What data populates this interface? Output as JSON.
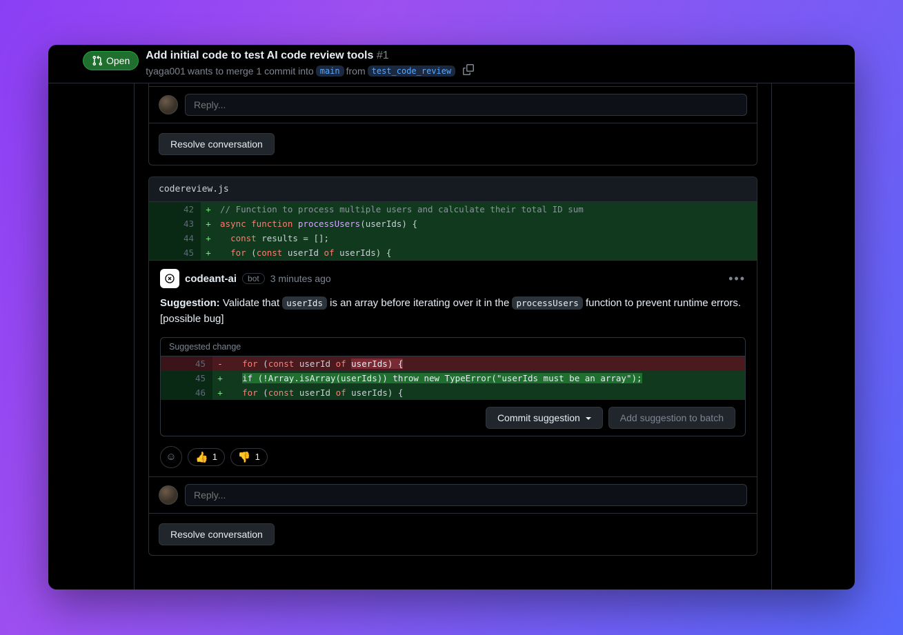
{
  "header": {
    "state": "Open",
    "title": "Add initial code to test AI code review tools",
    "number": "#1",
    "author": "tyaga001",
    "merge_text_1": " wants to merge 1 commit into ",
    "base_branch": "main",
    "merge_text_2": " from ",
    "head_branch": "test_code_review"
  },
  "panel1": {
    "reply_placeholder": "Reply...",
    "resolve_label": "Resolve conversation"
  },
  "code_panel": {
    "filename": "codereview.js",
    "lines": [
      {
        "n": "42",
        "m": "+",
        "code": "// Function to process multiple users and calculate their total ID sum",
        "cls": "comment"
      },
      {
        "n": "43",
        "m": "+",
        "code": [
          "async ",
          "function ",
          "processUsers",
          "(",
          "userIds",
          ") {"
        ]
      },
      {
        "n": "44",
        "m": "+",
        "code": [
          "  ",
          "const ",
          "results = [];"
        ]
      },
      {
        "n": "45",
        "m": "+",
        "code": [
          "  ",
          "for ",
          "(",
          "const ",
          "userId ",
          "of ",
          "userIds) {"
        ]
      }
    ]
  },
  "comment": {
    "author": "codeant-ai",
    "bot_label": "bot",
    "time": "3 minutes ago",
    "label_suggestion": "Suggestion:",
    "text_1": " Validate that ",
    "code_1": "userIds",
    "text_2": " is an array before iterating over it in the ",
    "code_2": "processUsers",
    "text_3": " function to prevent runtime errors. [possible bug]",
    "suggestion_header": "Suggested change",
    "commit_label": "Commit suggestion",
    "batch_label": "Add suggestion to batch"
  },
  "suggestion_diff": {
    "del": {
      "n": "45",
      "pre": "  ",
      "kw1": "for",
      "mid1": " (",
      "kw2": "const",
      "mid2": " userId ",
      "kw3": "of",
      "mid3": " ",
      "hl": "userIds) {"
    },
    "add1": {
      "n": "45",
      "pre": "  ",
      "hl": "if (!Array.isArray(userIds)) throw new TypeError(\"userIds must be an array\");"
    },
    "add2": {
      "n": "46",
      "pre": "  ",
      "kw1": "for",
      "mid1": " (",
      "kw2": "const",
      "mid2": " userId ",
      "kw3": "of",
      "mid3": " userIds) {"
    }
  },
  "reactions": {
    "thumbs_up": {
      "emoji": "👍",
      "count": "1"
    },
    "thumbs_down": {
      "emoji": "👎",
      "count": "1"
    }
  },
  "panel2": {
    "reply_placeholder": "Reply...",
    "resolve_label": "Resolve conversation"
  }
}
